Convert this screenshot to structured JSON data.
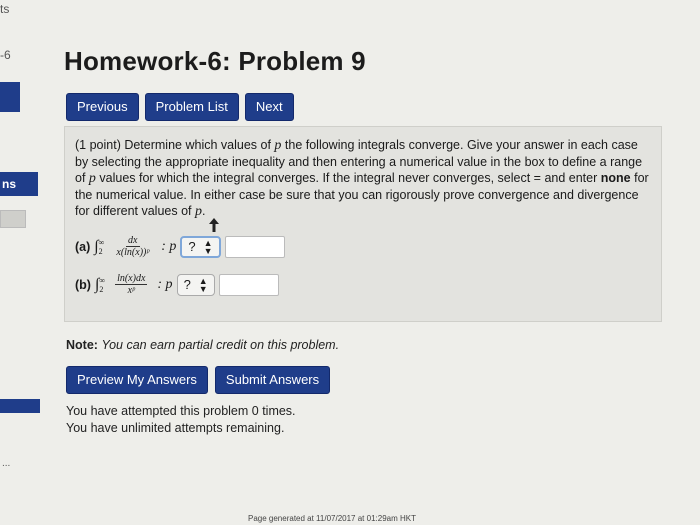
{
  "sidebar": {
    "top_text": "ts",
    "sub_text": "-6",
    "item_label": "ns",
    "ellipsis": "..."
  },
  "page_title": "Homework-6: Problem 9",
  "nav": {
    "previous": "Previous",
    "problem_list": "Problem List",
    "next": "Next"
  },
  "problem": {
    "intro": "(1 point) Determine which values of",
    "p": "p",
    "text_a": "the following integrals converge. Give your answer in each case by selecting the appropriate inequality and then entering a numerical value in the box to define a range of",
    "text_b": "values for which the integral converges. If the integral never converges, select = and enter",
    "none": "none",
    "text_c": "for the numerical value. In either case be sure that you can rigorously prove convergence and divergence for different values of",
    "period": ".",
    "part_a": {
      "label": "(a)",
      "upper": "∞",
      "lower": "2",
      "numerator": "dx",
      "denominator": "x(ln(x))ᵖ",
      "colon_p": ": p",
      "select_value": "?",
      "answer": ""
    },
    "part_b": {
      "label": "(b)",
      "upper": "∞",
      "lower": "2",
      "numerator": "ln(x)dx",
      "denominator": "xᵖ",
      "colon_p": ": p",
      "select_value": "?",
      "answer": ""
    }
  },
  "note": {
    "label": "Note:",
    "text": "You can earn partial credit on this problem."
  },
  "actions": {
    "preview": "Preview My Answers",
    "submit": "Submit Answers"
  },
  "attempts": {
    "line1": "You have attempted this problem 0 times.",
    "line2": "You have unlimited attempts remaining."
  },
  "footer": "Page generated at 11/07/2017 at 01:29am HKT",
  "colors": {
    "button_blue": "#1f3d8a",
    "background": "#eeeeea",
    "problem_box": "#e3e3df"
  }
}
